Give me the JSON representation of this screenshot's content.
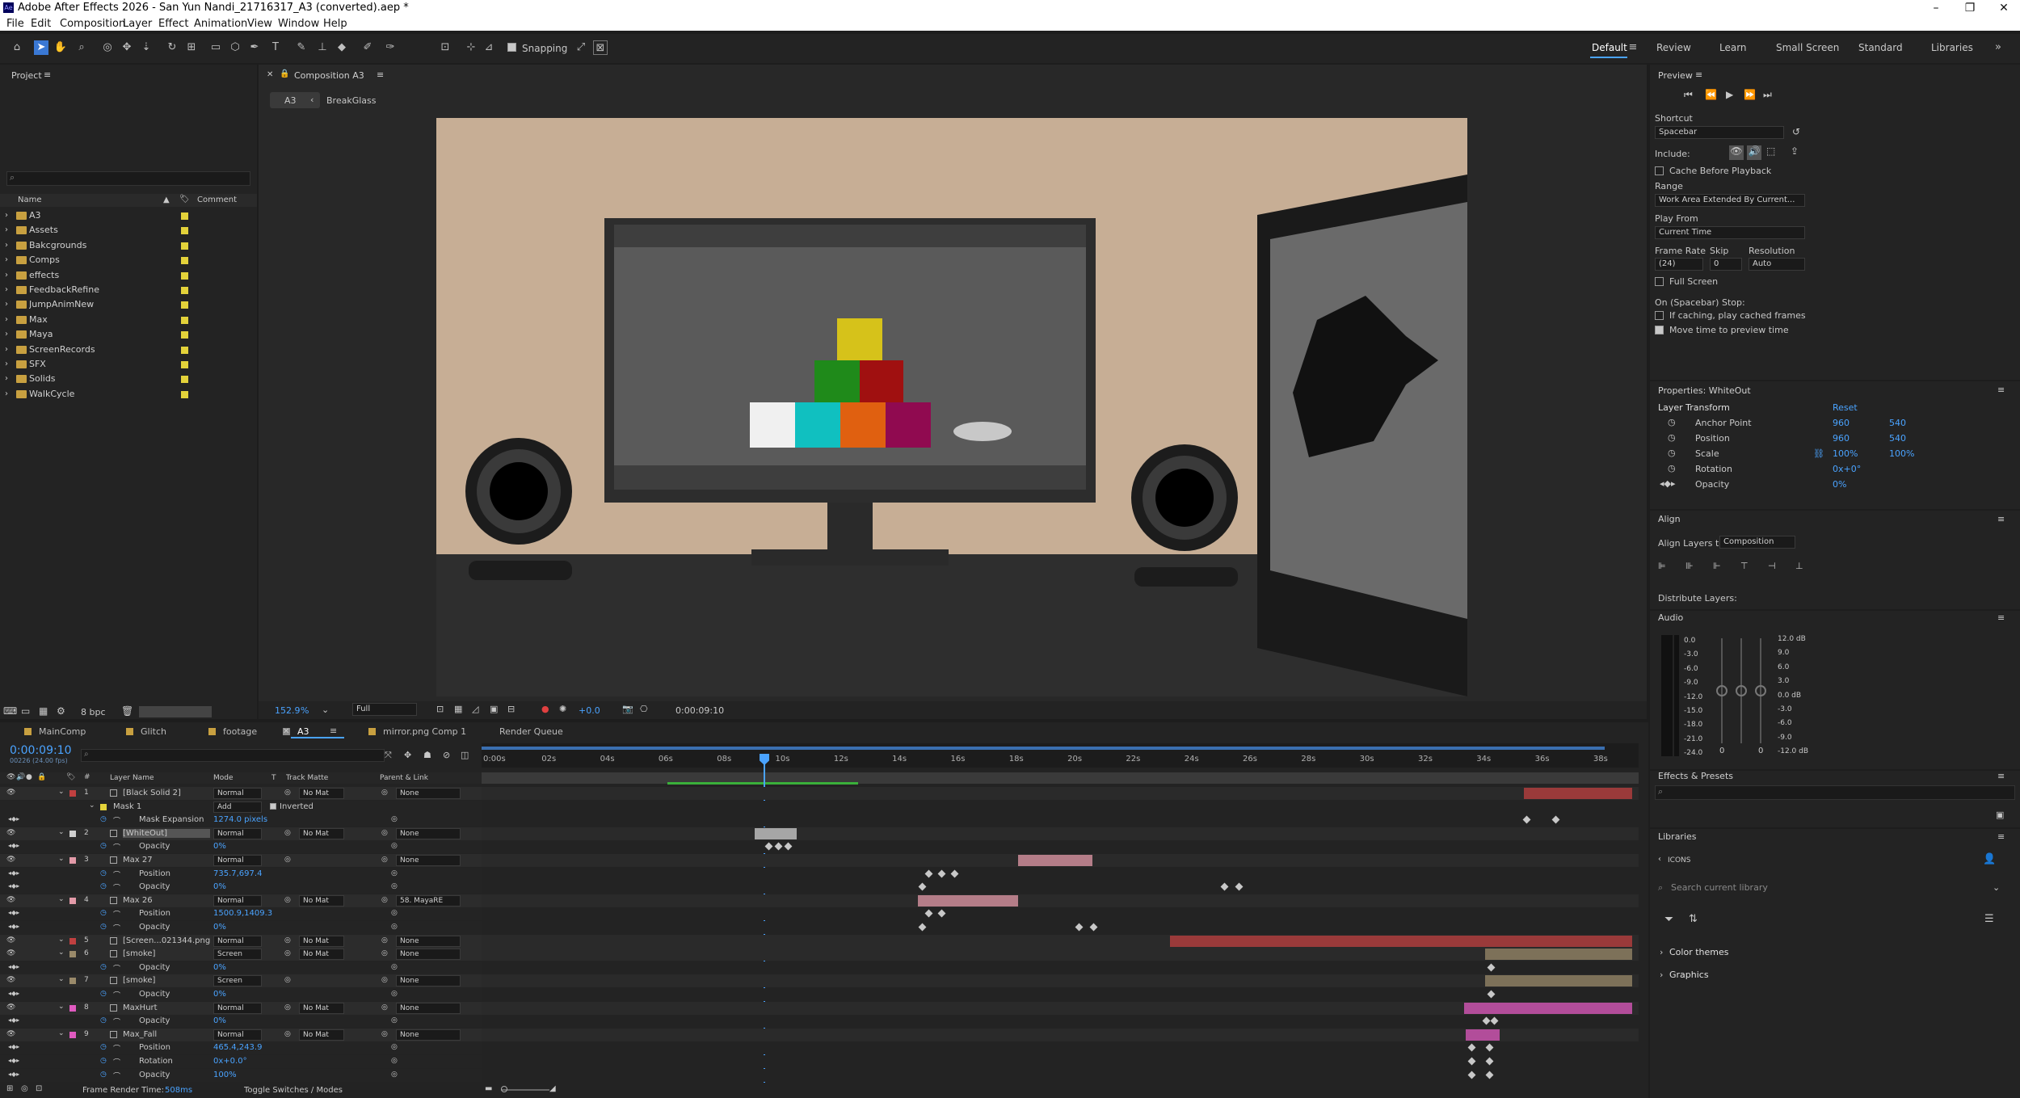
{
  "app": {
    "title": "Adobe After Effects 2026 - San Yun Nandi_21716317_A3 (converted).aep *",
    "logo_text": "Ae"
  },
  "menu": [
    "File",
    "Edit",
    "Composition",
    "Layer",
    "Effect",
    "Animation",
    "View",
    "Window",
    "Help"
  ],
  "toolbar": {
    "snapping_label": "Snapping",
    "workspaces": [
      "Default",
      "Review",
      "Learn",
      "Small Screen",
      "Standard",
      "Libraries"
    ]
  },
  "project": {
    "title": "Project",
    "search_placeholder": "",
    "col_name": "Name",
    "col_comment": "Comment",
    "items": [
      "A3",
      "Assets",
      "Bakcgrounds",
      "Comps",
      "effects",
      "FeedbackRefine",
      "JumpAnimNew",
      "Max",
      "Maya",
      "ScreenRecords",
      "SFX",
      "Solids",
      "WalkCycle"
    ],
    "bpc": "8 bpc"
  },
  "composition": {
    "panel_title": "Composition A3",
    "breadcrumb": [
      "A3",
      "BreakGlass"
    ],
    "zoom": "152.9",
    "zoom_unit": "%",
    "resolution": "Full",
    "exposure": "+0.0",
    "timecode": "0:00:09:10",
    "colors": {
      "wall": "#c7ae95",
      "floor": "#2e2e2e",
      "bg": "#282828"
    }
  },
  "preview": {
    "title": "Preview",
    "shortcut_label": "Shortcut",
    "shortcut_value": "Spacebar",
    "include_label": "Include:",
    "cache_label": "Cache Before Playback",
    "range_label": "Range",
    "range_value": "Work Area Extended By Current...",
    "play_from_label": "Play From",
    "play_from_value": "Current Time",
    "frame_rate_label": "Frame Rate",
    "skip_label": "Skip",
    "resolution_label": "Resolution",
    "frame_rate_value": "(24)",
    "skip_value": "0",
    "resolution_value": "Auto",
    "full_screen_label": "Full Screen",
    "on_stop_label": "On (Spacebar) Stop:",
    "if_caching_label": "If caching, play cached frames",
    "move_time_label": "Move time to preview time"
  },
  "properties": {
    "title": "Properties: WhiteOut",
    "section": "Layer Transform",
    "reset": "Reset",
    "anchor_label": "Anchor Point",
    "anchor_x": "960",
    "anchor_y": "540",
    "position_label": "Position",
    "position_x": "960",
    "position_y": "540",
    "scale_label": "Scale",
    "scale_x": "100%",
    "scale_y": "100%",
    "rotation_label": "Rotation",
    "rotation_value": "0x+0°",
    "opacity_label": "Opacity",
    "opacity_value": "0%"
  },
  "align": {
    "title": "Align",
    "align_to_label": "Align Layers to:",
    "align_to_value": "Composition",
    "distribute_label": "Distribute Layers:"
  },
  "audio": {
    "title": "Audio",
    "left_scale": [
      "0.0",
      "-3.0",
      "-6.0",
      "-9.0",
      "-12.0",
      "-15.0",
      "-18.0",
      "-21.0",
      "-24.0"
    ],
    "right_scale": [
      "12.0 dB",
      "9.0",
      "6.0",
      "3.0",
      "0.0 dB",
      "-3.0",
      "-6.0",
      "-9.0",
      "-12.0 dB"
    ],
    "zero_a": "0",
    "zero_b": "0"
  },
  "effects_presets": {
    "title": "Effects & Presets",
    "search_placeholder": ""
  },
  "libraries": {
    "title": "Libraries",
    "back_label": "ICONS",
    "search_placeholder": "Search current library",
    "sections": [
      "Color themes",
      "Graphics"
    ]
  },
  "timeline": {
    "tabs": [
      "MainComp",
      "Glitch",
      "footage",
      "A3",
      "mirror.png Comp 1",
      "Render Queue"
    ],
    "timecode": "0:00:09:10",
    "frame_info": "00226 (24.00 fps)",
    "headers": {
      "layer_name": "Layer Name",
      "mode": "Mode",
      "t": "T",
      "track_matte": "Track Matte",
      "parent": "Parent & Link"
    },
    "ruler": [
      "0:00s",
      "02s",
      "04s",
      "06s",
      "08s",
      "10s",
      "12s",
      "14s",
      "16s",
      "18s",
      "20s",
      "22s",
      "24s",
      "26s",
      "28s",
      "30s",
      "32s",
      "34s",
      "36s",
      "38s"
    ],
    "rows": [
      {
        "num": "1",
        "name": "[Black Solid 2]",
        "mode": "Normal",
        "matte": "No Mat",
        "parent": "None",
        "type": "layer",
        "color": "#c04040"
      },
      {
        "num": "",
        "name": "Mask 1",
        "mode": "Add",
        "matte": "Inverted",
        "parent": "",
        "type": "mask",
        "color": "#e3d23a"
      },
      {
        "num": "",
        "name": "Mask Expansion",
        "mode": "",
        "value": "1274.0 pixels",
        "type": "prop"
      },
      {
        "num": "2",
        "name": "[WhiteOut]",
        "mode": "Normal",
        "matte": "No Mat",
        "parent": "None",
        "type": "layer",
        "color": "#d0d0d0"
      },
      {
        "num": "",
        "name": "Opacity",
        "value": "0%",
        "type": "prop"
      },
      {
        "num": "3",
        "name": "Max 27",
        "mode": "Normal",
        "matte": "",
        "parent": "None",
        "type": "layer",
        "color": "#e39aa8"
      },
      {
        "num": "",
        "name": "Position",
        "value": "735.7,697.4",
        "type": "prop"
      },
      {
        "num": "",
        "name": "Opacity",
        "value": "0%",
        "type": "prop"
      },
      {
        "num": "4",
        "name": "Max 26",
        "mode": "Normal",
        "matte": "No Mat",
        "parent": "58. MayaRE",
        "type": "layer",
        "color": "#e39aa8"
      },
      {
        "num": "",
        "name": "Position",
        "value": "1500.9,1409.3",
        "type": "prop"
      },
      {
        "num": "",
        "name": "Opacity",
        "value": "0%",
        "type": "prop"
      },
      {
        "num": "5",
        "name": "[Screen...021344.png]",
        "mode": "Normal",
        "matte": "No Mat",
        "parent": "None",
        "type": "layer",
        "color": "#c04040"
      },
      {
        "num": "6",
        "name": "[smoke]",
        "mode": "Screen",
        "matte": "No Mat",
        "parent": "None",
        "type": "layer",
        "color": "#9a8a6a"
      },
      {
        "num": "",
        "name": "Opacity",
        "value": "0%",
        "type": "prop"
      },
      {
        "num": "7",
        "name": "[smoke]",
        "mode": "Screen",
        "matte": "",
        "parent": "None",
        "type": "layer",
        "color": "#9a8a6a"
      },
      {
        "num": "",
        "name": "Opacity",
        "value": "0%",
        "type": "prop"
      },
      {
        "num": "8",
        "name": "MaxHurt",
        "mode": "Normal",
        "matte": "No Mat",
        "parent": "None",
        "type": "layer",
        "color": "#e05ac0"
      },
      {
        "num": "",
        "name": "Opacity",
        "value": "0%",
        "type": "prop"
      },
      {
        "num": "9",
        "name": "Max_Fall",
        "mode": "Normal",
        "matte": "No Mat",
        "parent": "None",
        "type": "layer",
        "color": "#e05ac0"
      },
      {
        "num": "",
        "name": "Position",
        "value": "465.4,243.9",
        "type": "prop"
      },
      {
        "num": "",
        "name": "Rotation",
        "value": "0x+0.0°",
        "type": "prop"
      },
      {
        "num": "",
        "name": "Opacity",
        "value": "100%",
        "type": "prop"
      }
    ],
    "footer_render_label": "Frame Render Time:",
    "footer_render_value": "508ms",
    "footer_toggle": "Toggle Switches / Modes"
  }
}
